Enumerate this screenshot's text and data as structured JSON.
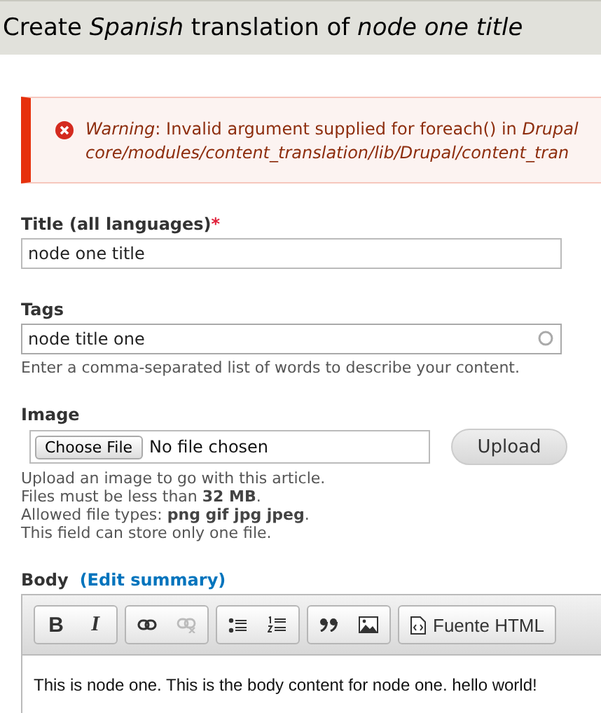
{
  "page_title": "Create *Spanish* translation of *node one title*",
  "message": {
    "kind": "error",
    "lines": [
      "*Warning*: Invalid argument supplied for foreach() in *Drupal*",
      "*core/modules/content_translation/lib/Drupal/content_tran*"
    ]
  },
  "title_field": {
    "label": "Title (all languages)",
    "required_mark": "*",
    "value": "node one title"
  },
  "tags_field": {
    "label": "Tags",
    "value": "node title one",
    "description": "Enter a comma-separated list of words to describe your content."
  },
  "image_field": {
    "label": "Image",
    "choose_button": "Choose File",
    "file_status": "No file chosen",
    "upload_button": "Upload",
    "description": [
      "Upload an image to go with this article.",
      "Files must be less than **32 MB**.",
      "Allowed file types: **png gif jpg jpeg**.",
      "This field can store only one file."
    ]
  },
  "body_field": {
    "label": "Body",
    "summary_link": "(Edit summary)",
    "toolbar": [
      [
        {
          "kind": "bold",
          "text": "B",
          "disabled": false
        },
        {
          "kind": "italic",
          "text": "I",
          "disabled": false
        }
      ],
      [
        {
          "kind": "link",
          "disabled": false
        },
        {
          "kind": "unlink",
          "disabled": true
        }
      ],
      [
        {
          "kind": "bullets",
          "disabled": false
        },
        {
          "kind": "numbers",
          "disabled": false
        }
      ],
      [
        {
          "kind": "quote",
          "disabled": false
        },
        {
          "kind": "image",
          "disabled": false
        }
      ],
      [
        {
          "kind": "source",
          "text": "Fuente HTML",
          "disabled": false
        }
      ]
    ],
    "content": "This is node one.  This is the body content for node one. hello world!"
  }
}
